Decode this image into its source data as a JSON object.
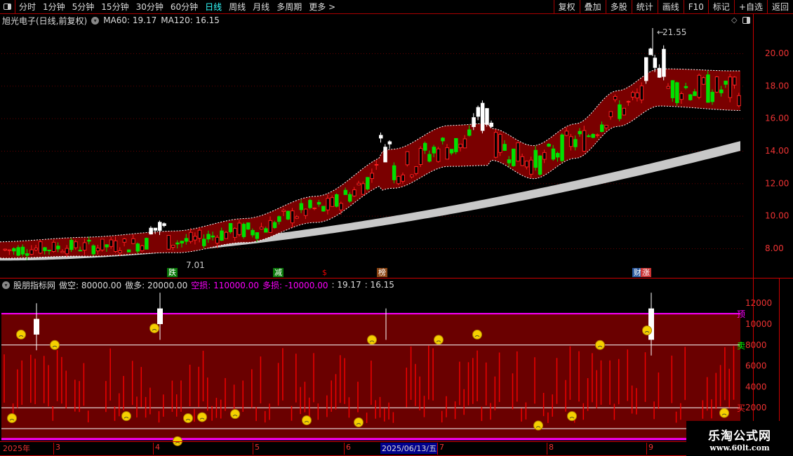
{
  "toolbar": {
    "periods": [
      "分时",
      "1分钟",
      "5分钟",
      "15分钟",
      "30分钟",
      "60分钟",
      "日线",
      "周线",
      "月线",
      "多周期",
      "更多 >"
    ],
    "active": "日线",
    "buttons": [
      "复权",
      "叠加",
      "多股",
      "统计",
      "画线",
      "F10",
      "标记",
      "+自选",
      "返回"
    ]
  },
  "info": {
    "title": "旭光电子(日线,前复权)",
    "ma60": "MA60: 19.17",
    "ma120": "MA120: 16.15"
  },
  "price_axis": [
    "20.00",
    "18.00",
    "16.00",
    "14.00",
    "12.00",
    "10.00",
    "8.00"
  ],
  "high_label": "21.55",
  "low_label": "7.01",
  "tags": [
    {
      "text": "跌",
      "color": "#0a7a0a"
    },
    {
      "text": "减",
      "color": "#0a7a0a"
    },
    {
      "text": "$",
      "color": "#e00"
    },
    {
      "text": "榜",
      "color": "#8b4513"
    },
    {
      "text": "财",
      "color": "#2a5aa0"
    },
    {
      "text": "涨",
      "color": "#c33"
    }
  ],
  "indicator": {
    "name": "股朋指标网",
    "short": "做空: 80000.00",
    "long": "做多: 20000.00",
    "short_loss": "空损: 110000.00",
    "long_loss": "多损: -10000.00",
    "v1": ": 19.17",
    "v2": ": 16.15",
    "axis": [
      "12000",
      "10000",
      "8000",
      "6000",
      "4000",
      "2000"
    ],
    "marks": {
      "top": "顶",
      "sell": "卖",
      "buy": "买"
    }
  },
  "dates": {
    "year": "2025年",
    "months": [
      "3",
      "4",
      "5",
      "6",
      "7",
      "8",
      "9"
    ],
    "selected": "2025/06/13/五"
  },
  "watermark": {
    "name": "乐淘公式网",
    "url": "www.60lt.com"
  },
  "colors": {
    "band": "#7a0000",
    "up": "#ff2020",
    "down": "#00e000",
    "ma_band": "#c8c8c8",
    "magenta": "#ff00ff"
  }
}
